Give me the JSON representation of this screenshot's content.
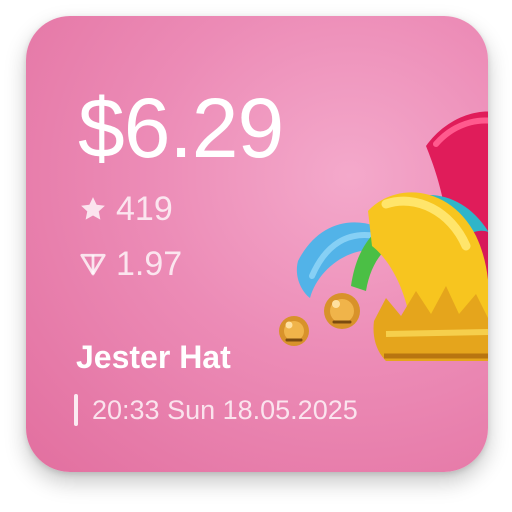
{
  "item": {
    "price": "$6.29",
    "stars": "419",
    "gem_value": "1.97",
    "name": "Jester Hat",
    "timestamp": "20:33 Sun 18.05.2025"
  },
  "icons": {
    "stars_icon": "star-icon",
    "gem_icon": "gem-icon",
    "image": "jester-hat-icon"
  },
  "colors": {
    "card_background": "#ec8bb6",
    "text_primary": "#ffffff"
  }
}
